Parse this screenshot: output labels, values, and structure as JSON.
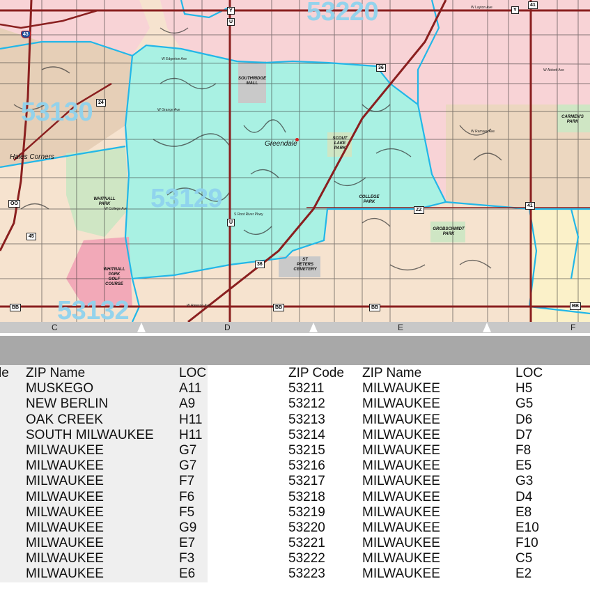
{
  "map": {
    "zip_labels": [
      "53220",
      "53130",
      "53129",
      "53132"
    ],
    "place_labels": [
      "Hales Corners",
      "Greendale"
    ],
    "park_labels": [
      "SOUTHRIDGE MALL",
      "SCOUT LAKE PARK",
      "WHITNALL PARK",
      "COLLEGE PARK",
      "GROBSCHMIDT PARK",
      "WHITNALL PARK GOLF COURSE",
      "ST PETERS CEMETERY",
      "CARMEN'S PARK"
    ],
    "route_shields": [
      "43",
      "24",
      "36",
      "41",
      "45",
      "36",
      "41",
      "BB",
      "BB",
      "BB",
      "BB",
      "U",
      "U",
      "Y",
      "Y",
      "OO",
      "ZZ"
    ],
    "street_names": [
      "W Edgerton Ave",
      "W Grange Ave",
      "W College Ave",
      "W Rawson Ave",
      "W Ramsey Ave",
      "W Abbott Ave",
      "S Root River Pkwy",
      "W Layton Ave"
    ],
    "colors": {
      "zip_53129": "#a9f1e3",
      "zip_53220": "#f8d3d6",
      "zip_53130": "#e6cfb7",
      "zip_53132": "#f6e3cf",
      "boundary": "#22b7e8",
      "highway": "#8a1f1f",
      "park": "#cfe6c4",
      "golf": "#f2a9b8",
      "zip_text": "#8fd3ee"
    }
  },
  "grid_columns": [
    "C",
    "D",
    "E",
    "F"
  ],
  "table": {
    "left": {
      "headers": [
        "le",
        "ZIP Name",
        "LOC"
      ],
      "rows": [
        [
          "MUSKEGO",
          "A11"
        ],
        [
          "NEW BERLIN",
          "A9"
        ],
        [
          "OAK CREEK",
          "H11"
        ],
        [
          "SOUTH MILWAUKEE",
          "H11"
        ],
        [
          "MILWAUKEE",
          "G7"
        ],
        [
          "MILWAUKEE",
          "G7"
        ],
        [
          "MILWAUKEE",
          "F7"
        ],
        [
          "MILWAUKEE",
          "F6"
        ],
        [
          "MILWAUKEE",
          "F5"
        ],
        [
          "MILWAUKEE",
          "G9"
        ],
        [
          "MILWAUKEE",
          "E7"
        ],
        [
          "MILWAUKEE",
          "F3"
        ],
        [
          "MILWAUKEE",
          "E6"
        ]
      ]
    },
    "right": {
      "headers": [
        "ZIP Code",
        "ZIP Name",
        "LOC"
      ],
      "rows": [
        [
          "53211",
          "MILWAUKEE",
          "H5"
        ],
        [
          "53212",
          "MILWAUKEE",
          "G5"
        ],
        [
          "53213",
          "MILWAUKEE",
          "D6"
        ],
        [
          "53214",
          "MILWAUKEE",
          "D7"
        ],
        [
          "53215",
          "MILWAUKEE",
          "F8"
        ],
        [
          "53216",
          "MILWAUKEE",
          "E5"
        ],
        [
          "53217",
          "MILWAUKEE",
          "G3"
        ],
        [
          "53218",
          "MILWAUKEE",
          "D4"
        ],
        [
          "53219",
          "MILWAUKEE",
          "E8"
        ],
        [
          "53220",
          "MILWAUKEE",
          "E10"
        ],
        [
          "53221",
          "MILWAUKEE",
          "F10"
        ],
        [
          "53222",
          "MILWAUKEE",
          "C5"
        ],
        [
          "53223",
          "MILWAUKEE",
          "E2"
        ]
      ]
    }
  }
}
